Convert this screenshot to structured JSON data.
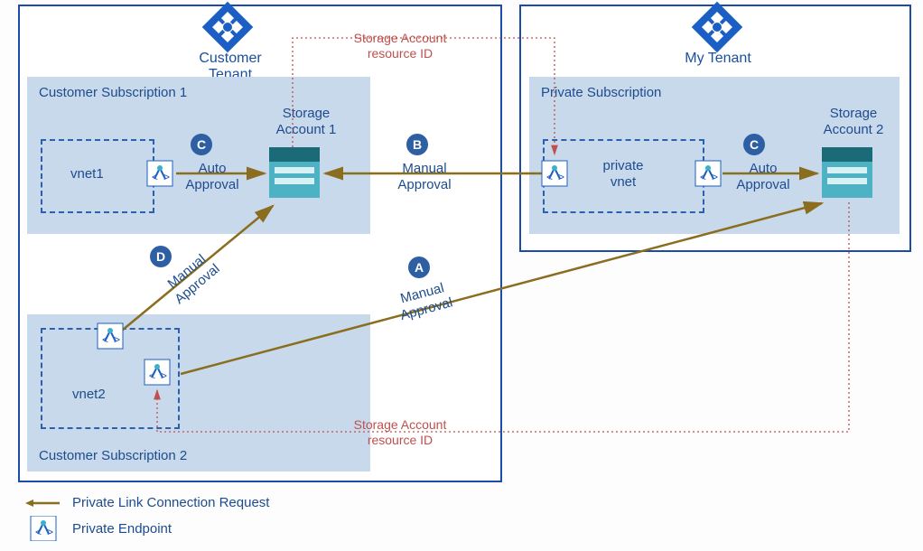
{
  "tenants": {
    "customer": {
      "label": "Customer Tenant"
    },
    "my": {
      "label": "My Tenant"
    }
  },
  "subscriptions": {
    "cust1": {
      "title": "Customer Subscription 1"
    },
    "cust2": {
      "title": "Customer Subscription 2"
    },
    "private": {
      "title": "Private Subscription"
    }
  },
  "vnets": {
    "vnet1": {
      "label": "vnet1"
    },
    "vnet2": {
      "label": "vnet2"
    },
    "private": {
      "label": "private\nvnet"
    }
  },
  "storage": {
    "s1": {
      "label": "Storage\nAccount 1"
    },
    "s2": {
      "label": "Storage\nAccount 2"
    }
  },
  "connections": {
    "A": {
      "badge": "A",
      "label": "Manual\nApproval"
    },
    "B": {
      "badge": "B",
      "label": "Manual\nApproval"
    },
    "C1": {
      "badge": "C",
      "label": "Auto\nApproval"
    },
    "C2": {
      "badge": "C",
      "label": "Auto\nApproval"
    },
    "D": {
      "badge": "D",
      "label": "Manual\nApproval"
    }
  },
  "annotations": {
    "sa_resource_id_top": "Storage Account\nresource ID",
    "sa_resource_id_bottom": "Storage Account\nresource ID"
  },
  "legend": {
    "link_request": "Private Link Connection Request",
    "endpoint": "Private Endpoint"
  },
  "colors": {
    "azure_blue": "#1c4ca8",
    "box_fill": "#c9d9ec",
    "arrow": "#8a6d1e",
    "dotted": "#c0504d"
  }
}
